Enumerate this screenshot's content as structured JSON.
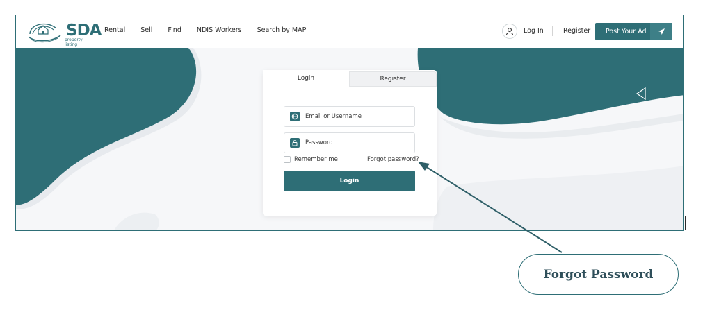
{
  "colors": {
    "brand": "#2e6e76",
    "brand_light": "#3d7f87",
    "hero_bg": "#f6f7f9"
  },
  "logo": {
    "text": "SDA",
    "subtitle": "property listing"
  },
  "nav": {
    "items": [
      {
        "label": "Rental"
      },
      {
        "label": "Sell"
      },
      {
        "label": "Find"
      },
      {
        "label": "NDIS Workers"
      },
      {
        "label": "Search by MAP"
      }
    ]
  },
  "header": {
    "login_label": "Log In",
    "register_label": "Register",
    "post_ad_label": "Post Your Ad"
  },
  "login_card": {
    "tabs": [
      {
        "label": "Login",
        "active": true
      },
      {
        "label": "Register",
        "active": false
      }
    ],
    "email_placeholder": "Email or Username",
    "password_placeholder": "Password",
    "remember_label": "Remember me",
    "forgot_label": "Forgot password?",
    "submit_label": "Login"
  },
  "annotation": {
    "label": "Forgot Password"
  },
  "icons": {
    "user": "user-icon",
    "send": "send-icon",
    "globe": "globe-icon",
    "lock": "lock-icon",
    "back": "triangle-left-icon"
  }
}
